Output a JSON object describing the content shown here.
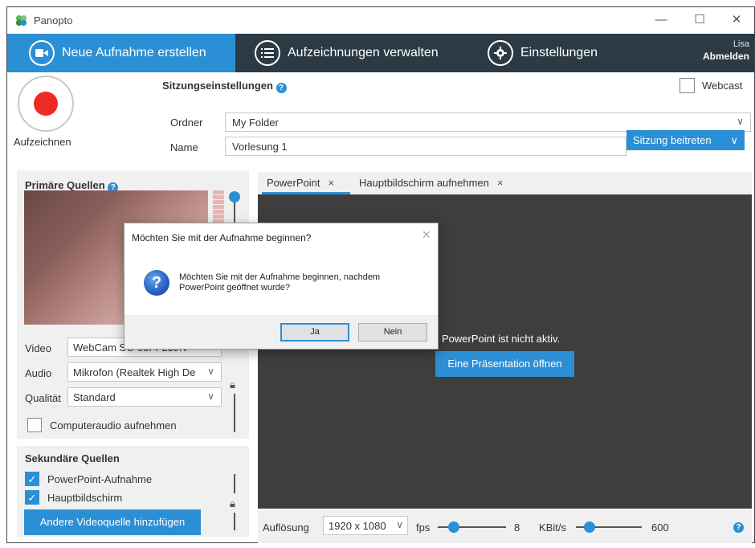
{
  "window": {
    "title": "Panopto",
    "controls": {
      "minimize": "—",
      "maximize": "☐",
      "close": "✕"
    }
  },
  "nav": {
    "new_recording": "Neue Aufnahme erstellen",
    "manage_recordings": "Aufzeichnungen verwalten",
    "settings": "Einstellungen",
    "user_name": "Lisa",
    "sign_out": "Abmelden"
  },
  "record": {
    "label": "Aufzeichnen"
  },
  "session": {
    "title": "Sitzungseinstellungen",
    "help": "?",
    "webcast_label": "Webcast",
    "folder_label": "Ordner",
    "folder_value": "My Folder",
    "name_label": "Name",
    "name_value": "Vorlesung 1",
    "join_button": "Sitzung beitreten"
  },
  "primary": {
    "title": "Primäre Quellen",
    "video_label": "Video",
    "video_value": "WebCam SC-03FFL39N",
    "audio_label": "Audio",
    "audio_value": "Mikrofon (Realtek High De",
    "quality_label": "Qualität",
    "quality_value": "Standard",
    "computer_audio_label": "Computeraudio aufnehmen"
  },
  "secondary": {
    "title": "Sekundäre Quellen",
    "items": [
      {
        "label": "PowerPoint-Aufnahme",
        "checked": true
      },
      {
        "label": "Hauptbildschirm",
        "checked": true
      }
    ],
    "add_button": "Andere Videoquelle hinzufügen"
  },
  "tabs": [
    {
      "label": "PowerPoint",
      "close": "×",
      "active": true
    },
    {
      "label": "Hauptbildschirm aufnehmen",
      "close": "×",
      "active": false
    }
  ],
  "preview": {
    "status": "PowerPoint ist nicht aktiv.",
    "open_button": "Eine Präsentation öffnen"
  },
  "bottom": {
    "resolution_label": "Auflösung",
    "resolution_value": "1920 x 1080",
    "fps_label": "fps",
    "fps_value": "8",
    "bitrate_label": "KBit/s",
    "bitrate_value": "600"
  },
  "dialog": {
    "title": "Möchten Sie mit der Aufnahme beginnen?",
    "message_line1": "Möchten Sie mit der Aufnahme beginnen, nachdem",
    "message_line2": "PowerPoint geöffnet wurde?",
    "yes": "Ja",
    "no": "Nein",
    "icon": "question-icon"
  },
  "colors": {
    "accent": "#2b8fd6",
    "nav_bg": "#2b3a44",
    "record_red": "#ee2b23",
    "preview_bg": "#3e3e3e"
  }
}
